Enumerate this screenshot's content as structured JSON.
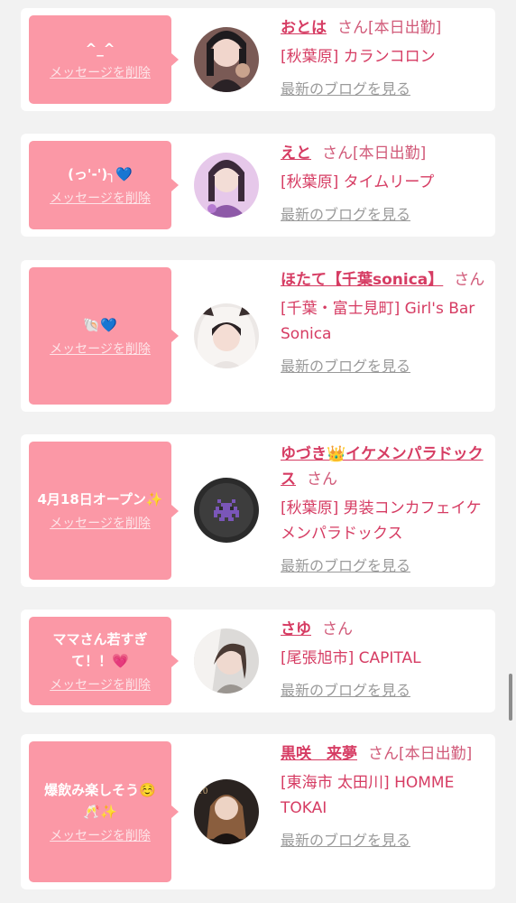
{
  "cards": [
    {
      "message": "^_^",
      "delete_label": "メッセージを削除",
      "name": "おとは",
      "honorific": "さん",
      "status": "[本日出勤]",
      "shop": "[秋葉原] カランコロン",
      "blog_label": "最新のブログを見る"
    },
    {
      "message": "(っ'-')╮💙",
      "delete_label": "メッセージを削除",
      "name": "えと",
      "honorific": "さん",
      "status": "[本日出勤]",
      "shop": "[秋葉原] タイムリープ",
      "blog_label": "最新のブログを見る"
    },
    {
      "message": "🐚💙",
      "delete_label": "メッセージを削除",
      "name": "ほたて【千葉sonica】",
      "honorific": "さん",
      "status": "",
      "shop": "[千葉・富士見町] Girl's Bar Sonica",
      "blog_label": "最新のブログを見る"
    },
    {
      "message": "4月18日オープン✨",
      "delete_label": "メッセージを削除",
      "name": "ゆづき👑イケメンパラドックス",
      "honorific": "さん",
      "status": "",
      "shop": "[秋葉原] 男装コンカフェイケメンパラドックス",
      "blog_label": "最新のブログを見る"
    },
    {
      "message": "ママさん若すぎて！！💗",
      "delete_label": "メッセージを削除",
      "name": "さゆ",
      "honorific": "さん",
      "status": "",
      "shop": "[尾張旭市] CAPITAL",
      "blog_label": "最新のブログを見る"
    },
    {
      "message": "爆飲み楽しそう☺️🥂✨",
      "delete_label": "メッセージを削除",
      "name": "黒咲　来夢",
      "honorific": "さん",
      "status": "[本日出勤]",
      "shop": "[東海市 太田川] HOMME TOKAI",
      "blog_label": "最新のブログを見る"
    }
  ],
  "colors": {
    "accent": "#d63c63",
    "bubble": "#fb98a6",
    "background": "#f2f2f2",
    "muted": "#9a9a9a"
  },
  "icons": [
    "avatar-photo",
    "avatar-photo",
    "avatar-photo",
    "space-invader-avatar",
    "avatar-photo",
    "avatar-photo"
  ]
}
